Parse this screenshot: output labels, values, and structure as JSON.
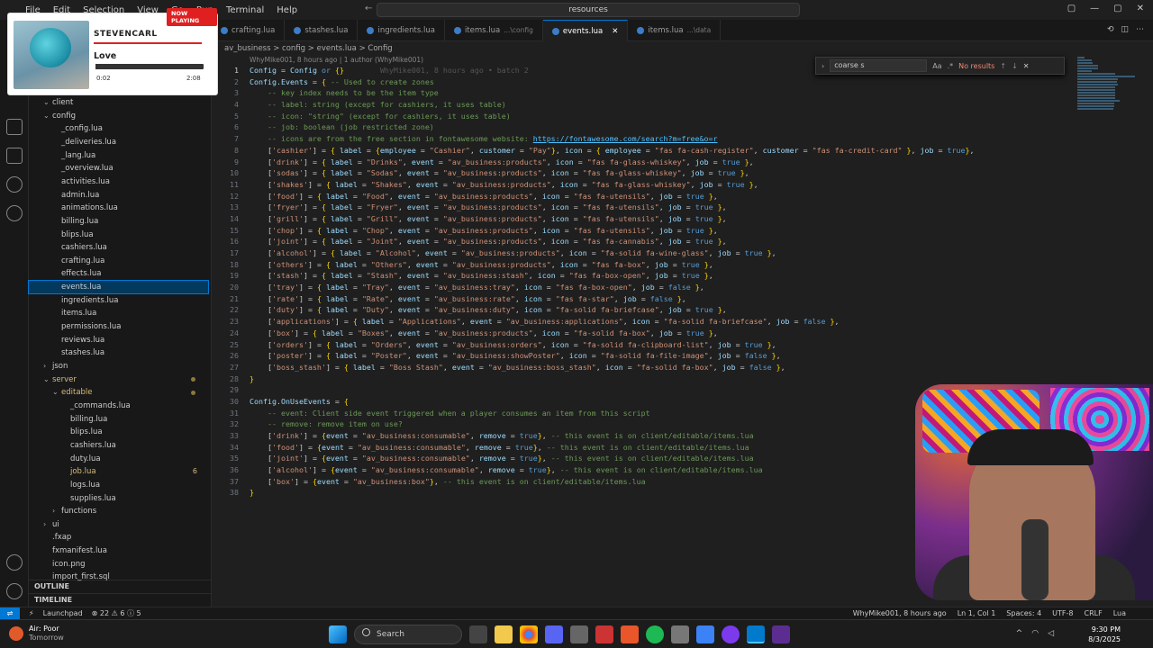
{
  "titlebar": {
    "menu": [
      "File",
      "Edit",
      "Selection",
      "View",
      "Go",
      "Run",
      "Terminal",
      "Help"
    ],
    "command_center": "resources",
    "nav_back": "←",
    "nav_forward": "→"
  },
  "tabs": [
    {
      "label": "crafting.lua",
      "path": "",
      "active": false
    },
    {
      "label": "stashes.lua",
      "path": "",
      "active": false
    },
    {
      "label": "ingredients.lua",
      "path": "",
      "active": false
    },
    {
      "label": "items.lua",
      "path": "...\\config",
      "active": false
    },
    {
      "label": "events.lua",
      "path": "",
      "active": true
    },
    {
      "label": "items.lua",
      "path": "...\\data",
      "active": false
    }
  ],
  "breadcrumb": "av_business > config > events.lua > Config",
  "blame_header": "WhyMike001, 8 hours ago | 1 author (WhyMike001)",
  "blame_inline": "WhyMike001, 8 hours ago • batch 2",
  "find": {
    "value": "coarse s",
    "result": "No results"
  },
  "sidebar": {
    "items": [
      {
        "label": "client",
        "kind": "folder",
        "indent": 1,
        "open": true
      },
      {
        "label": "config",
        "kind": "folder",
        "indent": 1,
        "open": true
      },
      {
        "label": "_config.lua",
        "kind": "file",
        "indent": 2
      },
      {
        "label": "_deliveries.lua",
        "kind": "file",
        "indent": 2
      },
      {
        "label": "_lang.lua",
        "kind": "file",
        "indent": 2
      },
      {
        "label": "_overview.lua",
        "kind": "file",
        "indent": 2
      },
      {
        "label": "activities.lua",
        "kind": "file",
        "indent": 2
      },
      {
        "label": "admin.lua",
        "kind": "file",
        "indent": 2
      },
      {
        "label": "animations.lua",
        "kind": "file",
        "indent": 2
      },
      {
        "label": "billing.lua",
        "kind": "file",
        "indent": 2
      },
      {
        "label": "blips.lua",
        "kind": "file",
        "indent": 2
      },
      {
        "label": "cashiers.lua",
        "kind": "file",
        "indent": 2
      },
      {
        "label": "crafting.lua",
        "kind": "file",
        "indent": 2
      },
      {
        "label": "effects.lua",
        "kind": "file",
        "indent": 2
      },
      {
        "label": "events.lua",
        "kind": "file",
        "indent": 2,
        "selected": true
      },
      {
        "label": "ingredients.lua",
        "kind": "file",
        "indent": 2
      },
      {
        "label": "items.lua",
        "kind": "file",
        "indent": 2
      },
      {
        "label": "permissions.lua",
        "kind": "file",
        "indent": 2
      },
      {
        "label": "reviews.lua",
        "kind": "file",
        "indent": 2
      },
      {
        "label": "stashes.lua",
        "kind": "file",
        "indent": 2
      },
      {
        "label": "json",
        "kind": "folder",
        "indent": 1,
        "open": false
      },
      {
        "label": "server",
        "kind": "folder",
        "indent": 1,
        "open": true,
        "modified": true
      },
      {
        "label": "editable",
        "kind": "folder",
        "indent": 2,
        "open": true,
        "modified": true
      },
      {
        "label": "_commands.lua",
        "kind": "file",
        "indent": 3
      },
      {
        "label": "billing.lua",
        "kind": "file",
        "indent": 3
      },
      {
        "label": "blips.lua",
        "kind": "file",
        "indent": 3
      },
      {
        "label": "cashiers.lua",
        "kind": "file",
        "indent": 3
      },
      {
        "label": "duty.lua",
        "kind": "file",
        "indent": 3
      },
      {
        "label": "job.lua",
        "kind": "file",
        "indent": 3,
        "modified": true,
        "badge": "6"
      },
      {
        "label": "logs.lua",
        "kind": "file",
        "indent": 3
      },
      {
        "label": "supplies.lua",
        "kind": "file",
        "indent": 3
      },
      {
        "label": "functions",
        "kind": "folder",
        "indent": 2,
        "open": false
      },
      {
        "label": "ui",
        "kind": "folder",
        "indent": 1,
        "open": false
      },
      {
        "label": ".fxap",
        "kind": "file",
        "indent": 1
      },
      {
        "label": "fxmanifest.lua",
        "kind": "file",
        "indent": 1
      },
      {
        "label": "icon.png",
        "kind": "file",
        "indent": 1
      },
      {
        "label": "import_first.sql",
        "kind": "file",
        "indent": 1
      }
    ],
    "outline": "OUTLINE",
    "timeline": "TIMELINE"
  },
  "code_lines": [
    "Config = Config or {}",
    "Config.Events = { -- Used to create zones",
    "    -- key index needs to be the item type",
    "    -- label: string (except for cashiers, it uses table)",
    "    -- icon: \"string\" (except for cashiers, it uses table)",
    "    -- job: boolean (job restricted zone)",
    "    -- icons are from the free section in fontawesome website: https://fontawesome.com/search?m=free&o=r",
    "    ['cashier'] = { label = {employee = \"Cashier\", customer = \"Pay\"}, icon = { employee = \"fas fa-cash-register\", customer = \"fas fa-credit-card\" }, job = true},",
    "    ['drink'] = { label = \"Drinks\", event = \"av_business:products\", icon = \"fas fa-glass-whiskey\", job = true },",
    "    ['sodas'] = { label = \"Sodas\", event = \"av_business:products\", icon = \"fas fa-glass-whiskey\", job = true },",
    "    ['shakes'] = { label = \"Shakes\", event = \"av_business:products\", icon = \"fas fa-glass-whiskey\", job = true },",
    "    ['food'] = { label = \"Food\", event = \"av_business:products\", icon = \"fas fa-utensils\", job = true },",
    "    ['fryer'] = { label = \"Fryer\", event = \"av_business:products\", icon = \"fas fa-utensils\", job = true },",
    "    ['grill'] = { label = \"Grill\", event = \"av_business:products\", icon = \"fas fa-utensils\", job = true },",
    "    ['chop'] = { label = \"Chop\", event = \"av_business:products\", icon = \"fas fa-utensils\", job = true },",
    "    ['joint'] = { label = \"Joint\", event = \"av_business:products\", icon = \"fas fa-cannabis\", job = true },",
    "    ['alcohol'] = { label = \"Alcohol\", event = \"av_business:products\", icon = \"fa-solid fa-wine-glass\", job = true },",
    "    ['others'] = { label = \"Others\", event = \"av_business:products\", icon = \"fas fa-box\", job = true },",
    "    ['stash'] = { label = \"Stash\", event = \"av_business:stash\", icon = \"fas fa-box-open\", job = true },",
    "    ['tray'] = { label = \"Tray\", event = \"av_business:tray\", icon = \"fas fa-box-open\", job = false },",
    "    ['rate'] = { label = \"Rate\", event = \"av_business:rate\", icon = \"fas fa-star\", job = false },",
    "    ['duty'] = { label = \"Duty\", event = \"av_business:duty\", icon = \"fa-solid fa-briefcase\", job = true },",
    "    ['applications'] = { label = \"Applications\", event = \"av_business:applications\", icon = \"fa-solid fa-briefcase\", job = false },",
    "    ['box'] = { label = \"Boxes\", event = \"av_business:products\", icon = \"fa-solid fa-box\", job = true },",
    "    ['orders'] = { label = \"Orders\", event = \"av_business:orders\", icon = \"fa-solid fa-clipboard-list\", job = true },",
    "    ['poster'] = { label = \"Poster\", event = \"av_business:showPoster\", icon = \"fa-solid fa-file-image\", job = false },",
    "    ['boss_stash'] = { label = \"Boss Stash\", event = \"av_business:boss_stash\", icon = \"fa-solid fa-box\", job = false },",
    "}",
    "",
    "Config.OnUseEvents = {",
    "    -- event: Client side event triggered when a player consumes an item from this script",
    "    -- remove: remove item on use?",
    "    ['drink'] = {event = \"av_business:consumable\", remove = true}, -- this event is on client/editable/items.lua",
    "    ['food'] = {event = \"av_business:consumable\", remove = true}, -- this event is on client/editable/items.lua",
    "    ['joint'] = {event = \"av_business:consumable\", remove = true}, -- this event is on client/editable/items.lua",
    "    ['alcohol'] = {event = \"av_business:consumable\", remove = true}, -- this event is on client/editable/items.lua",
    "    ['box'] = {event = \"av_business:box\"}, -- this event is on client/editable/items.lua",
    "}"
  ],
  "status": {
    "branch_icon": "⚡",
    "launchpad": "Launchpad",
    "errors": "22",
    "warnings": "6",
    "infos": "5",
    "blame": "WhyMike001, 8 hours ago",
    "position": "Ln 1, Col 1",
    "spaces": "Spaces: 4",
    "encoding": "UTF-8",
    "eol": "CRLF",
    "language": "Lua"
  },
  "taskbar": {
    "weather_title": "Air: Poor",
    "weather_sub": "Tomorrow",
    "search": "Search",
    "time": "9:30 PM",
    "date": "8/3/2025"
  },
  "now_playing": {
    "tag": "NOW PLAYING",
    "artist": "STEVENCARL",
    "title": "Love",
    "elapsed": "0:02",
    "duration": "2:08",
    "progress": 0.02
  },
  "colors": {
    "accent": "#0078d4",
    "selection": "#04395e",
    "now_playing_red": "#e02020"
  }
}
